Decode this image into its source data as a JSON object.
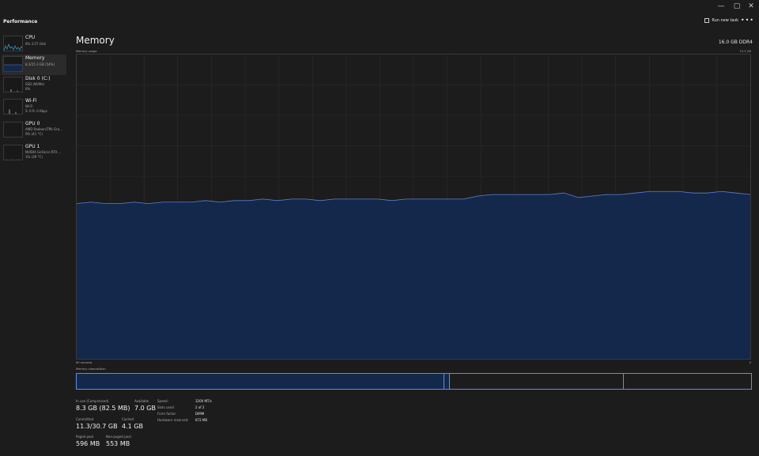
{
  "window": {
    "controls": {
      "minimize": "—",
      "maximize": "▢",
      "close": "✕"
    }
  },
  "header": {
    "title": "Performance",
    "run_new_task": "Run new task",
    "more": "•••"
  },
  "sidebar": {
    "items": [
      {
        "name": "CPU",
        "sub1": "6%  3.57 GHz",
        "sub2": "",
        "selected": false
      },
      {
        "name": "Memory",
        "sub1": "8.3/15.3 GB (54%)",
        "sub2": "",
        "selected": true
      },
      {
        "name": "Disk 0 (C:)",
        "sub1": "SSD (NVMe)",
        "sub2": "0%",
        "selected": false
      },
      {
        "name": "Wi-Fi",
        "sub1": "Wi-Fi",
        "sub2": "S: 0  R: 0 Kbps",
        "selected": false
      },
      {
        "name": "GPU 0",
        "sub1": "AMD Radeon(TM) Gra...",
        "sub2": "0% (41 °C)",
        "selected": false
      },
      {
        "name": "GPU 1",
        "sub1": "NVIDIA GeForce RTX ...",
        "sub2": "1% (39 °C)",
        "selected": false
      }
    ]
  },
  "memory": {
    "title": "Memory",
    "spec": "16.0 GB DDR4",
    "usage_label": "Memory usage",
    "usage_max": "15.3 GB",
    "time_left": "60 seconds",
    "time_right": "0",
    "composition_label": "Memory composition",
    "usage_history_pct": [
      51,
      51.5,
      51,
      51,
      51.5,
      51,
      51.5,
      51.5,
      51.5,
      52,
      51.5,
      52,
      52,
      52.5,
      52,
      52.5,
      52.5,
      52,
      52.5,
      52.5,
      52.5,
      52.5,
      52,
      52.5,
      52.5,
      52.5,
      52.5,
      52.5,
      53.5,
      54,
      54,
      54,
      54,
      54,
      54.5,
      53,
      53.5,
      54,
      54,
      54.5,
      55,
      55,
      55,
      54.5,
      54.5,
      55,
      54.5,
      54
    ]
  },
  "stats": {
    "in_use_label": "In use (Compressed)",
    "in_use_value": "8.3 GB (82.5 MB)",
    "available_label": "Available",
    "available_value": "7.0 GB",
    "committed_label": "Committed",
    "committed_value": "11.3/30.7 GB",
    "cached_label": "Cached",
    "cached_value": "4.1 GB",
    "paged_pool_label": "Paged pool",
    "paged_pool_value": "596 MB",
    "non_paged_pool_label": "Non-paged pool",
    "non_paged_pool_value": "553 MB"
  },
  "specs": {
    "speed_label": "Speed:",
    "speed_value": "3200 MT/s",
    "slots_label": "Slots used:",
    "slots_value": "2 of 2",
    "form_label": "Form factor:",
    "form_value": "DIMM",
    "hw_label": "Hardware reserved:",
    "hw_value": "672 MB"
  },
  "colors": {
    "accent": "#6a8ae0",
    "memory_fill": "#13284b",
    "memory_line": "#5d7fd6",
    "cpu_line": "#3aa0d8",
    "disk_line": "#4caf50",
    "wifi_line": "#c05ab8",
    "gpu_line": "#a04ca0"
  }
}
